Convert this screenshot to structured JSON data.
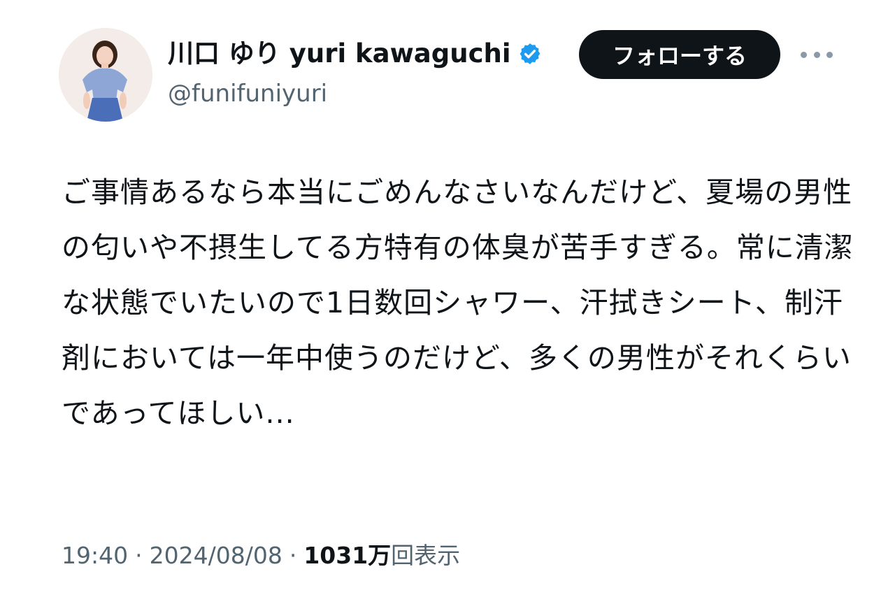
{
  "profile": {
    "display_name": "川口 ゆり yuri kawaguchi",
    "handle": "@funifuniyuri",
    "verified_icon": "verified-badge-icon",
    "verified_color": "#1d9bf0"
  },
  "actions": {
    "follow_label": "フォローする",
    "more_icon": "more-horizontal-icon"
  },
  "tweet": {
    "text": "ご事情あるなら本当にごめんなさいなんだけど、夏場の男性の匂いや不摂生してる方特有の体臭が苦手すぎる。常に清潔な状態でいたいので1日数回シャワー、汗拭きシート、制汗剤においては一年中使うのだけど、多くの男性がそれくらいであってほしい..."
  },
  "meta": {
    "time": "19:40",
    "separator": "·",
    "date": "2024/08/08",
    "views_count": "1031万",
    "views_label": "回表示"
  }
}
